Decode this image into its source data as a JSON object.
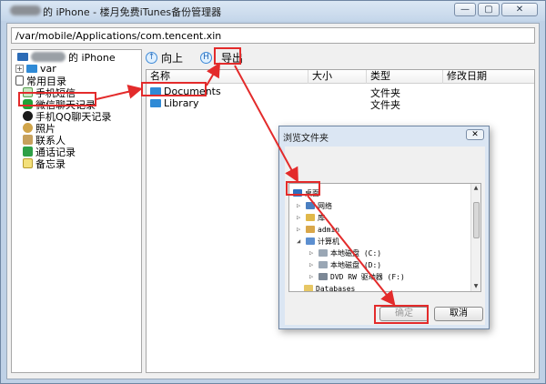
{
  "window": {
    "title": "的 iPhone - 楼月免费iTunes备份管理器",
    "min": "—",
    "max": "▢",
    "close": "✕"
  },
  "path": "/var/mobile/Applications/com.tencent.xin",
  "tree": {
    "root_label": "的 iPhone",
    "var_label": "var",
    "common_dir": "常用目录",
    "items": [
      "手机短信",
      "微信聊天记录",
      "手机QQ聊天记录",
      "照片",
      "联系人",
      "通话记录",
      "备忘录"
    ]
  },
  "toolbar": {
    "up_label": "向上",
    "export_label": "导出"
  },
  "list": {
    "columns": [
      "名称",
      "大小",
      "类型",
      "修改日期"
    ],
    "rows": [
      {
        "name": "Documents",
        "size": "",
        "type": "文件夹",
        "date": ""
      },
      {
        "name": "Library",
        "size": "",
        "type": "文件夹",
        "date": ""
      }
    ]
  },
  "dialog": {
    "title": "浏览文件夹",
    "close": "✕",
    "nodes": [
      "桌面",
      "网络",
      "库",
      "admin",
      "计算机",
      "本地磁盘 (C:)",
      "本地磁盘 (D:)",
      "DVD RW 驱动器 (F:)",
      "Databases"
    ],
    "ok_label": "确定",
    "cancel_label": "取消"
  },
  "colors": {
    "highlight": "#e32b2b",
    "accent": "#2f8ad6"
  }
}
